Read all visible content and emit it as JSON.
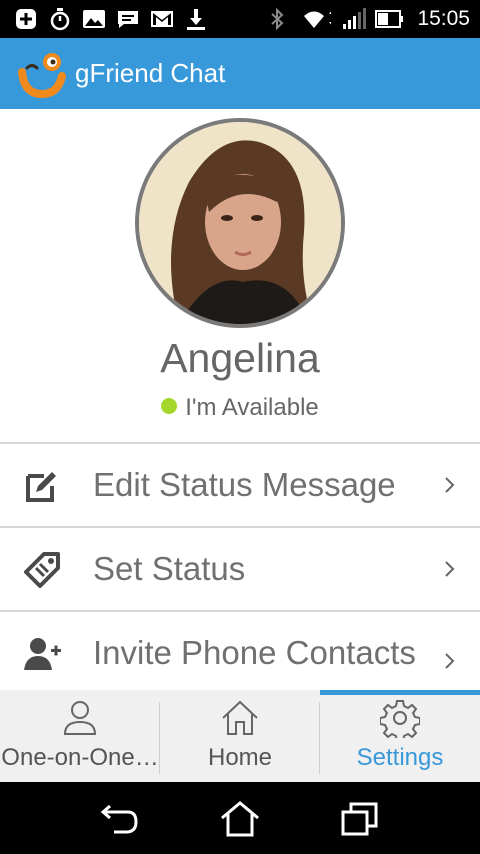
{
  "status_bar": {
    "time": "15:05",
    "left_icons": [
      "add-box-icon",
      "stopwatch-icon",
      "image-icon",
      "chat-bubble-icon",
      "gmail-icon",
      "download-icon"
    ],
    "right_icons": [
      "bluetooth-icon",
      "wifi-icon",
      "signal-icon",
      "battery-icon"
    ]
  },
  "app_bar": {
    "title": "gFriend Chat",
    "logo": "gfriend-logo"
  },
  "profile": {
    "name": "Angelina",
    "status_text": "I'm Available",
    "status_color": "#a5d62a"
  },
  "menu": {
    "items": [
      {
        "label": "Edit Status Message",
        "icon": "edit-icon"
      },
      {
        "label": "Set Status",
        "icon": "tag-icon"
      },
      {
        "label": "Invite Phone Contacts",
        "icon": "add-person-icon"
      }
    ]
  },
  "tabs": {
    "items": [
      {
        "label": "One-on-One…",
        "icon": "person-icon"
      },
      {
        "label": "Home",
        "icon": "home-icon"
      },
      {
        "label": "Settings",
        "icon": "gear-icon",
        "active": true
      }
    ]
  },
  "colors": {
    "accent": "#3798da",
    "text": "#707070"
  }
}
